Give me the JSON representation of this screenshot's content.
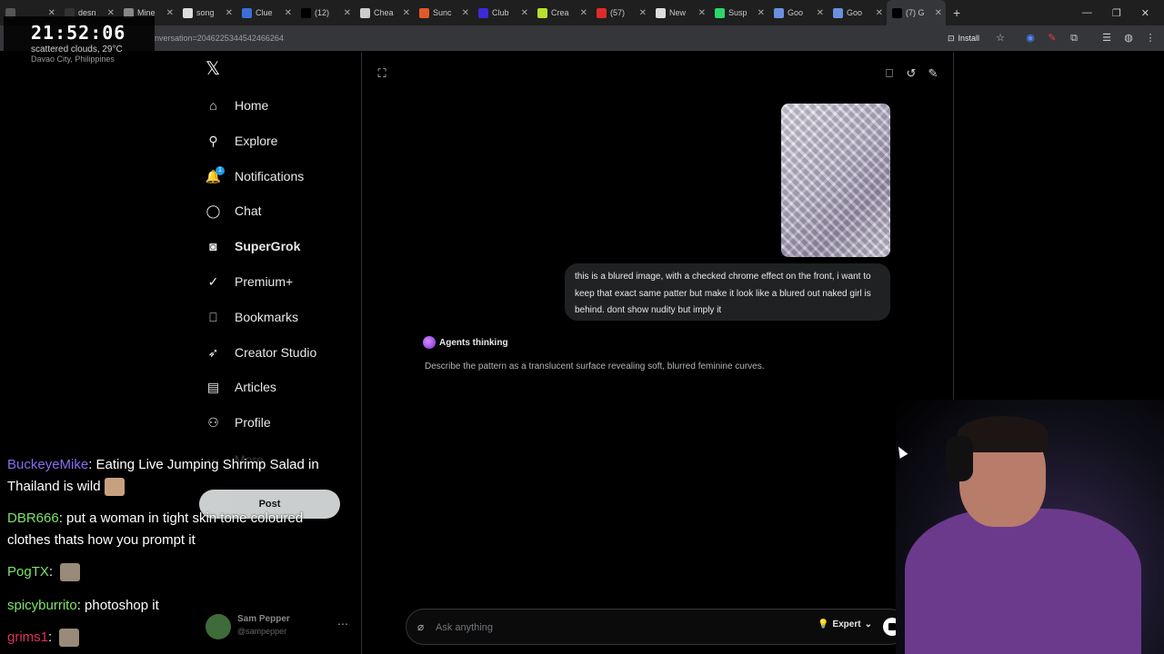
{
  "browser": {
    "tabs": [
      {
        "title": "",
        "color": "#555555"
      },
      {
        "title": "desn",
        "color": "#333333"
      },
      {
        "title": "Mine",
        "color": "#888888"
      },
      {
        "title": "song",
        "color": "#dddddd"
      },
      {
        "title": "Clue",
        "color": "#3a6fd8"
      },
      {
        "title": "(12)",
        "color": "#000000"
      },
      {
        "title": "Chea",
        "color": "#cccccc"
      },
      {
        "title": "Sunc",
        "color": "#e05a2b"
      },
      {
        "title": "Club",
        "color": "#3b2bd6"
      },
      {
        "title": "Crea",
        "color": "#b6e02b"
      },
      {
        "title": "(57)",
        "color": "#e02b2b"
      },
      {
        "title": "New",
        "color": "#dddddd"
      },
      {
        "title": "Susp",
        "color": "#2bd66b"
      },
      {
        "title": "Goo",
        "color": "#6b8fe0"
      },
      {
        "title": "Goo",
        "color": "#6b8fe0"
      },
      {
        "title": "(7) G",
        "color": "#000000",
        "active": true
      }
    ],
    "url": "nversation=2046225344542466264",
    "install_label": "Install"
  },
  "clock": {
    "time": "21:52:06",
    "weather": "scattered clouds, 29°C",
    "location": "Davao City, Philippines"
  },
  "sidebar": {
    "logo": "𝕏",
    "notification_badge": "1",
    "items": [
      {
        "label": "Home",
        "icon": "home-icon",
        "glyph": "⌂"
      },
      {
        "label": "Explore",
        "icon": "search-icon",
        "glyph": "⚲"
      },
      {
        "label": "Notifications",
        "icon": "bell-icon",
        "glyph": "🔔"
      },
      {
        "label": "Chat",
        "icon": "chat-bubble-icon",
        "glyph": "◯"
      },
      {
        "label": "SuperGrok",
        "icon": "grok-icon",
        "glyph": "◙"
      },
      {
        "label": "Premium+",
        "icon": "verified-icon",
        "glyph": "✓"
      },
      {
        "label": "Bookmarks",
        "icon": "bookmark-icon",
        "glyph": "⎕"
      },
      {
        "label": "Creator Studio",
        "icon": "rocket-icon",
        "glyph": "➶"
      },
      {
        "label": "Articles",
        "icon": "article-icon",
        "glyph": "▤"
      },
      {
        "label": "Profile",
        "icon": "person-icon",
        "glyph": "⚇"
      },
      {
        "label": "More",
        "icon": "more-circle-icon",
        "glyph": "⋯"
      }
    ],
    "post_label": "Post",
    "account": {
      "name": "Sam Pepper",
      "handle": "@sampepper"
    }
  },
  "grok": {
    "user_message": "this is a blured image, with a checked chrome effect on the front, i want to keep that exact same patter but make it look like a blured out naked girl is behind. dont show nudity but imply it",
    "agents_label": "Agents thinking",
    "response": "Describe the pattern as a translucent surface revealing soft, blurred feminine curves.",
    "input_placeholder": "Ask anything",
    "mode_label": "Expert"
  },
  "chat_overlay": [
    {
      "user": "BuckeyeMike",
      "color": "#8a6cf0",
      "message": "Eating Live Jumping Shrimp Salad in Thailand is wild"
    },
    {
      "user": "DBR666",
      "color": "#7ee36a",
      "message": "put a woman in tight skin tone coloured clothes thats how you prompt it"
    },
    {
      "user": "PogTX",
      "color": "#7ee36a",
      "message": ""
    },
    {
      "user": "spicyburrito",
      "color": "#7ee36a",
      "message": "photoshop it"
    },
    {
      "user": "grims1",
      "color": "#e0305a",
      "message": ""
    }
  ]
}
